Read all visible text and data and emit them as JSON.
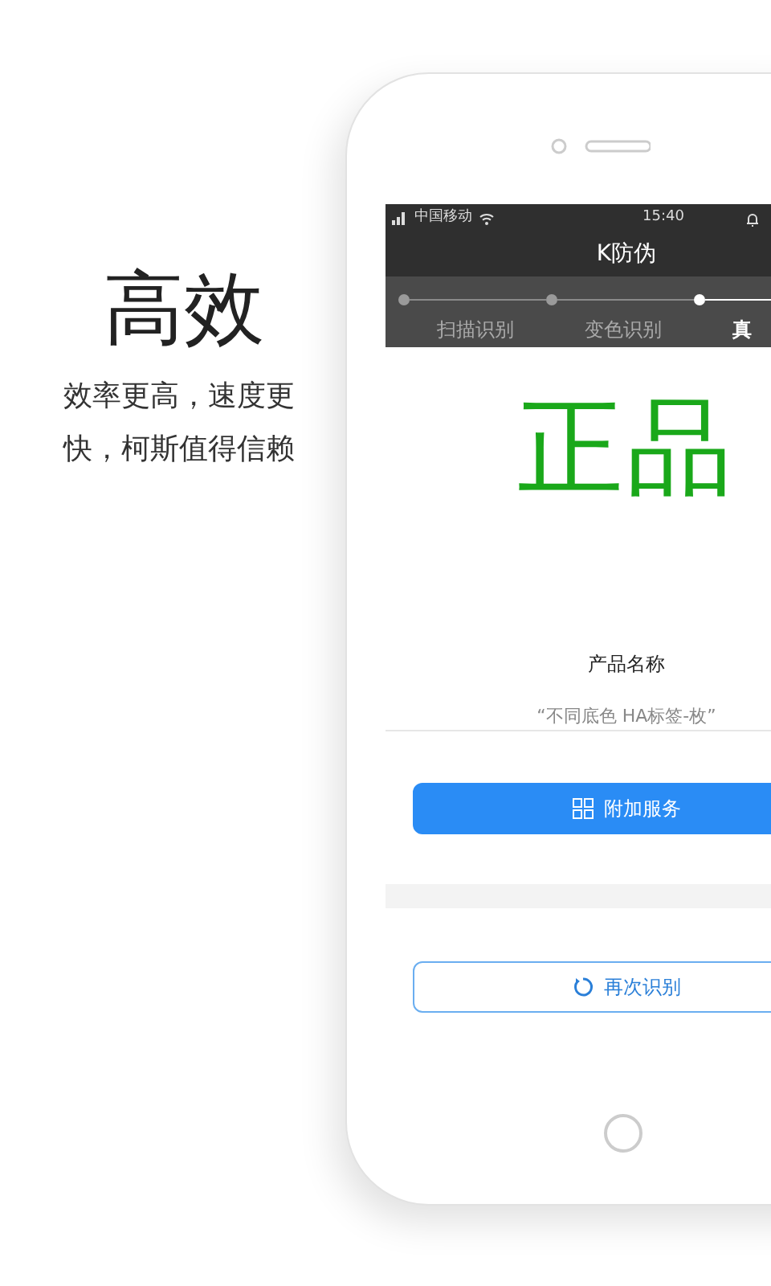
{
  "headline": "高效",
  "tagline": "效率更高，速度更快，柯斯值得信赖",
  "status_bar": {
    "carrier": "中国移动",
    "time": "15:40"
  },
  "app_bar": {
    "title": "K防伪"
  },
  "steps": [
    {
      "label": "扫描识别",
      "selected": false
    },
    {
      "label": "变色识别",
      "selected": false
    },
    {
      "label": "真",
      "selected": true
    }
  ],
  "result": {
    "verdict": "正品",
    "product_label": "产品名称",
    "product_name": "“不同底色 HA标签-枚”"
  },
  "buttons": [
    {
      "label": "附加服务",
      "kind": "primary"
    },
    {
      "label": "再次识别",
      "kind": "outline"
    }
  ]
}
